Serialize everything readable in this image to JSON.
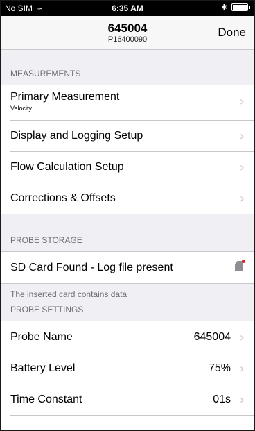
{
  "status_bar": {
    "carrier": "No SIM",
    "time": "6:35 AM",
    "bluetooth": "bluetooth-icon",
    "battery": "battery-icon"
  },
  "nav": {
    "title": "645004",
    "subtitle": "P16400090",
    "done_label": "Done"
  },
  "measurements": {
    "header": "MEASUREMENTS",
    "items": [
      {
        "label": "Primary Measurement",
        "sub": "Velocity"
      },
      {
        "label": "Display and Logging Setup"
      },
      {
        "label": "Flow Calculation Setup"
      },
      {
        "label": "Corrections & Offsets"
      }
    ]
  },
  "probe_storage": {
    "header": "PROBE STORAGE",
    "sd_label": "SD Card Found - Log file present",
    "note": "The inserted card contains data"
  },
  "probe_settings": {
    "header": "PROBE SETTINGS",
    "items": [
      {
        "label": "Probe Name",
        "value": "645004"
      },
      {
        "label": "Battery Level",
        "value": "75%"
      },
      {
        "label": "Time Constant",
        "value": "01s"
      }
    ]
  },
  "colors": {
    "background": "#efeff4",
    "separator": "#c8c7cc",
    "chevron": "#c7c7cc",
    "sd_dot": "#e0202a"
  }
}
